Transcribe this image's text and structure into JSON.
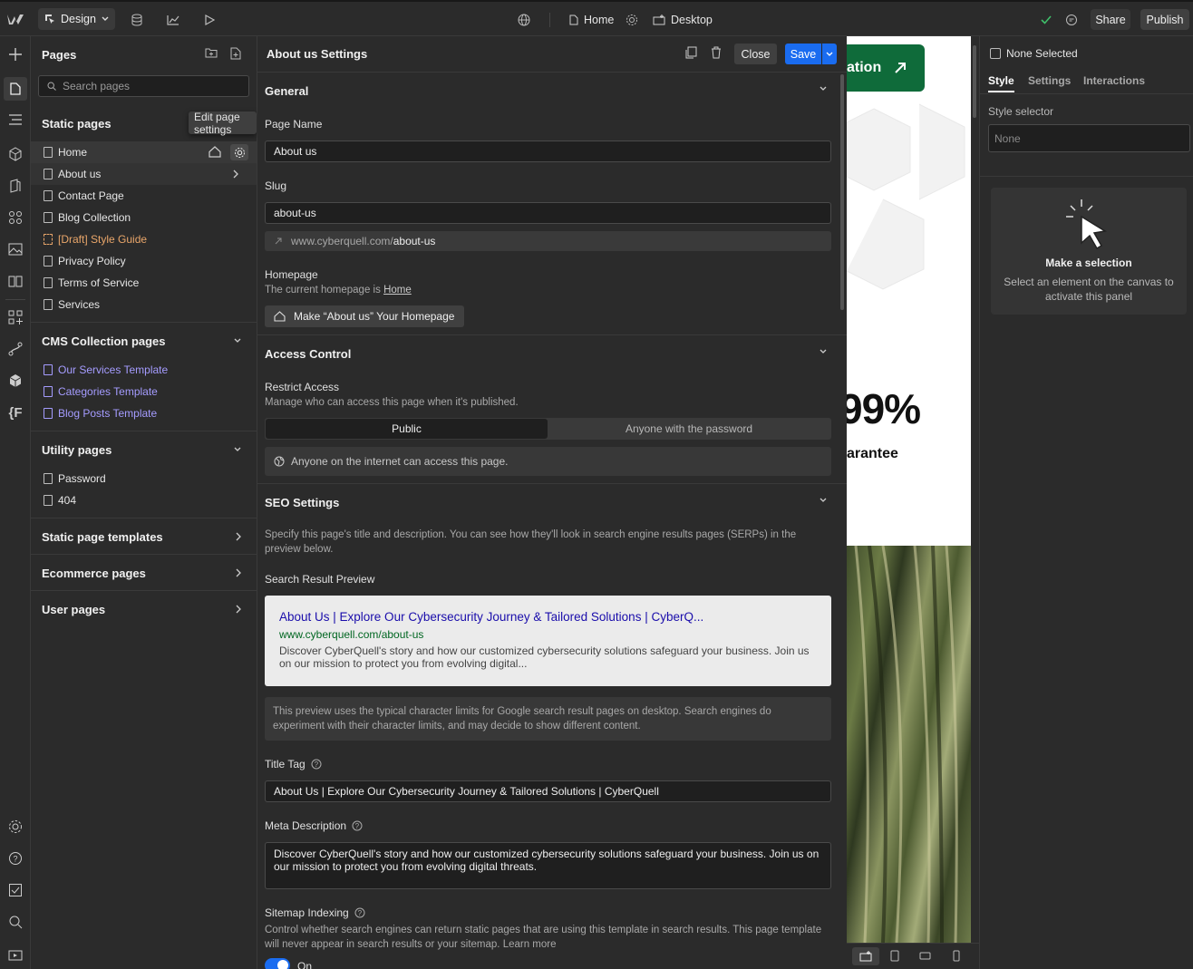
{
  "topbar": {
    "mode_label": "Design",
    "page_label": "Home",
    "breakpoint_label": "Desktop",
    "share_label": "Share",
    "publish_label": "Publish"
  },
  "pages_panel": {
    "title": "Pages",
    "search_placeholder": "Search pages",
    "tooltip": "Edit page settings",
    "static_title": "Static pages",
    "static_pages": [
      "Home",
      "About us",
      "Contact Page",
      "Blog Collection",
      "[Draft] Style Guide",
      "Privacy Policy",
      "Terms of Service",
      "Services"
    ],
    "cms_title": "CMS Collection pages",
    "cms_pages": [
      "Our Services Template",
      "Categories Template",
      "Blog Posts Template"
    ],
    "utility_title": "Utility pages",
    "utility_pages": [
      "Password",
      "404"
    ],
    "templates_title": "Static page templates",
    "ecommerce_title": "Ecommerce pages",
    "user_title": "User pages"
  },
  "settings": {
    "title": "About us Settings",
    "close_label": "Close",
    "save_label": "Save",
    "general_title": "General",
    "page_name_label": "Page Name",
    "page_name_value": "About us",
    "slug_label": "Slug",
    "slug_value": "about-us",
    "url_domain": "www.cyberquell.com/",
    "url_path": "about-us",
    "homepage_label": "Homepage",
    "homepage_text": "The current homepage is",
    "homepage_link": "Home",
    "make_home_label": "Make “About us” Your Homepage",
    "access_title": "Access Control",
    "restrict_label": "Restrict Access",
    "restrict_sub": "Manage who can access this page when it's published.",
    "access_public": "Public",
    "access_password": "Anyone with the password",
    "access_info": "Anyone on the internet can access this page.",
    "seo_title": "SEO Settings",
    "seo_desc": "Specify this page's title and description. You can see how they'll look in search engine results pages (SERPs) in the preview below.",
    "preview_label": "Search Result Preview",
    "preview_title": "About Us | Explore Our Cybersecurity Journey & Tailored Solutions | CyberQ...",
    "preview_url": "www.cyberquell.com/about-us",
    "preview_desc": "Discover CyberQuell's story and how our customized cybersecurity solutions safeguard your business. Join us on our mission to protect you from evolving digital...",
    "preview_note": "This preview uses the typical character limits for Google search result pages on desktop. Search engines do experiment with their character limits, and may decide to show different content.",
    "title_tag_label": "Title Tag",
    "title_tag_value": "About Us | Explore Our Cybersecurity Journey & Tailored Solutions | CyberQuell",
    "meta_label": "Meta Description",
    "meta_value": "Discover CyberQuell's story and how our customized cybersecurity solutions safeguard your business. Join us on our mission to protect you from evolving digital threats.",
    "sitemap_label": "Sitemap Indexing",
    "sitemap_desc": "Control whether search engines can return static pages that are using this template in search results. This page template will never appear in search results or your sitemap. Learn more",
    "sitemap_toggle": "On"
  },
  "canvas": {
    "cta_text": "ation",
    "big_number": "99%",
    "guarantee": "arantee",
    "accent": "#0f6b3a"
  },
  "right_panel": {
    "none_selected": "None Selected",
    "tab_style": "Style",
    "tab_settings": "Settings",
    "tab_interactions": "Interactions",
    "style_selector_label": "Style selector",
    "style_selector_value": "None",
    "empty_title": "Make a selection",
    "empty_desc": "Select an element on the canvas to activate this panel"
  },
  "colors": {
    "save_blue": "#1a6cf0",
    "link_purple": "#a59cff",
    "draft_orange": "#e9a66a"
  }
}
